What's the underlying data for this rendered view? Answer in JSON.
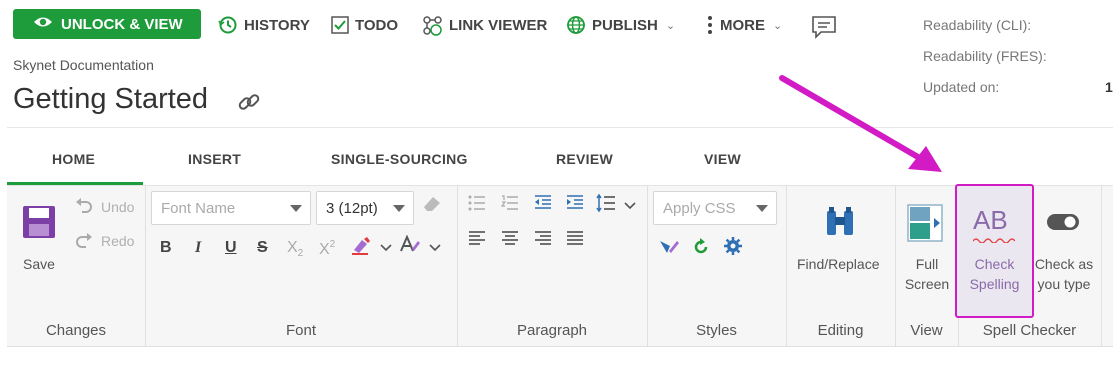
{
  "toolbar": {
    "unlock_label": "UNLOCK & VIEW",
    "history_label": "HISTORY",
    "todo_label": "TODO",
    "link_viewer_label": "LINK VIEWER",
    "publish_label": "PUBLISH",
    "more_label": "MORE",
    "caret": "⌄"
  },
  "document": {
    "breadcrumb": "Skynet Documentation",
    "title": "Getting Started"
  },
  "meta": {
    "readability_cli_label": "Readability (CLI):",
    "readability_fres_label": "Readability (FRES):",
    "updated_label": "Updated on:",
    "updated_value": "1"
  },
  "tabs": [
    {
      "label": "HOME"
    },
    {
      "label": "INSERT"
    },
    {
      "label": "SINGLE-SOURCING"
    },
    {
      "label": "REVIEW"
    },
    {
      "label": "VIEW"
    }
  ],
  "ribbon": {
    "changes": {
      "group_label": "Changes",
      "save_label": "Save",
      "undo_label": "Undo",
      "redo_label": "Redo"
    },
    "font": {
      "group_label": "Font",
      "font_name_placeholder": "Font Name",
      "font_size_value": "3 (12pt)",
      "bold": "B",
      "italic": "I",
      "underline": "U",
      "strike": "S",
      "subscript": "X",
      "sub_mark": "2",
      "superscript": "X",
      "sup_mark": "2"
    },
    "paragraph": {
      "group_label": "Paragraph"
    },
    "styles": {
      "group_label": "Styles",
      "apply_css_placeholder": "Apply CSS"
    },
    "editing": {
      "group_label": "Editing",
      "find_replace_label": "Find/Replace"
    },
    "view": {
      "group_label": "View",
      "full_screen_line1": "Full",
      "full_screen_line2": "Screen"
    },
    "spell_checker": {
      "group_label": "Spell Checker",
      "check_spelling_line1": "Check",
      "check_spelling_line2": "Spelling",
      "check_as_you_type_line1": "Check as",
      "check_as_you_type_line2": "you type",
      "ab_glyph": "AB"
    }
  },
  "colors": {
    "accent_green": "#1e9b3a",
    "highlight_magenta": "#d21bc4",
    "icon_blue": "#2f6fb3"
  }
}
